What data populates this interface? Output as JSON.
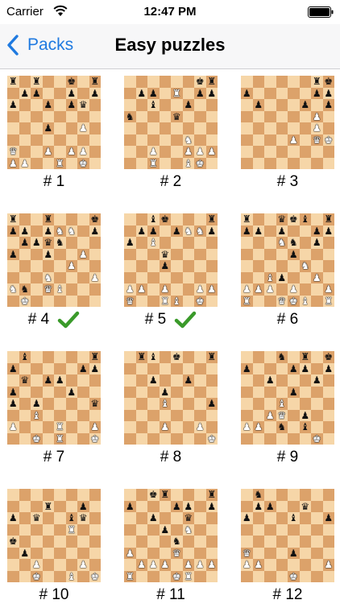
{
  "status_bar": {
    "carrier": "Carrier",
    "time": "12:47 PM"
  },
  "nav": {
    "back_label": "Packs",
    "title": "Easy puzzles"
  },
  "colors": {
    "accent": "#1f7ae0",
    "light_square": "#f6d6a8",
    "dark_square": "#dca26a",
    "check": "#3a9a2a"
  },
  "puzzles": [
    {
      "label": "# 1",
      "solved": false,
      "board": [
        "r.r..k.r",
        ".pp..p.p",
        "p..p.pq.",
        "........",
        "...p..P.",
        "........",
        "Q..P.PP.",
        "PP..R.K."
      ]
    },
    {
      "label": "# 2",
      "solved": false,
      "board": [
        "......kr",
        ".pp.R.pp",
        "..b..p..",
        "n...q...",
        "........",
        ".....N..",
        "..P..PPP",
        "..R..BK."
      ]
    },
    {
      "label": "# 3",
      "solved": false,
      "board": [
        "......rk",
        "p.....pp",
        ".p...p.p",
        "......P.",
        "......P.",
        "....P.QK",
        "........",
        "........"
      ]
    },
    {
      "label": "# 4",
      "solved": true,
      "board": [
        "r..r...k",
        "pp.pNN.p",
        ".ppqn...",
        "p..p..P.",
        ".....P..",
        "...N...P",
        "Nn.QB...",
        ".K......"
      ]
    },
    {
      "label": "# 5",
      "solved": true,
      "board": [
        "..bk...r",
        ".pp.pNNp",
        "p.B.....",
        "...q....",
        "...p....",
        "........",
        "PP.P..PP",
        "Q..RB.K."
      ]
    },
    {
      "label": "# 6",
      "solved": false,
      "board": [
        "r..qkb.r",
        "pp.p..pp",
        "...Nn.p.",
        "....p...",
        ".....N..",
        "..Bp..P.",
        "PPP.P..P",
        "R..QKB.R"
      ]
    },
    {
      "label": "# 7",
      "solved": false,
      "board": [
        ".b.....r",
        "p.....pp",
        ".q.pp...",
        "p....p..",
        "p.p....q",
        "..B.....",
        "P...R..P",
        "..K.R..K"
      ]
    },
    {
      "label": "# 8",
      "solved": false,
      "board": [
        ".rb.k..r",
        "........",
        "..p..p..",
        "...p....",
        "...B...p",
        "........",
        "...P..P.",
        ".......K"
      ]
    },
    {
      "label": "# 9",
      "solved": false,
      "board": [
        "...n.r.k",
        "p...pp.p",
        "..p...p.",
        "....p...",
        "...B....",
        "..PQ.p..",
        "PP.n.b..",
        "......K."
      ]
    },
    {
      "label": "# 10",
      "solved": false,
      "board": [
        "........",
        "...r..p.",
        "p.q..bq.",
        ".....R..",
        "k.......",
        ".p......",
        "..P...P.",
        "..K..B.K"
      ]
    },
    {
      "label": "# 11",
      "solved": false,
      "board": [
        "..kr...r",
        "p...pp.p",
        "..p..q..",
        "...p.N..",
        "....n...",
        "P...Q...",
        ".PPP.PPP",
        "R...KR.."
      ]
    },
    {
      "label": "# 12",
      "solved": false,
      "board": [
        ".n......",
        ".pp..q..",
        "p...b..p",
        "........",
        "........",
        "Q...p...",
        "PP.....P",
        "....K..."
      ]
    }
  ]
}
